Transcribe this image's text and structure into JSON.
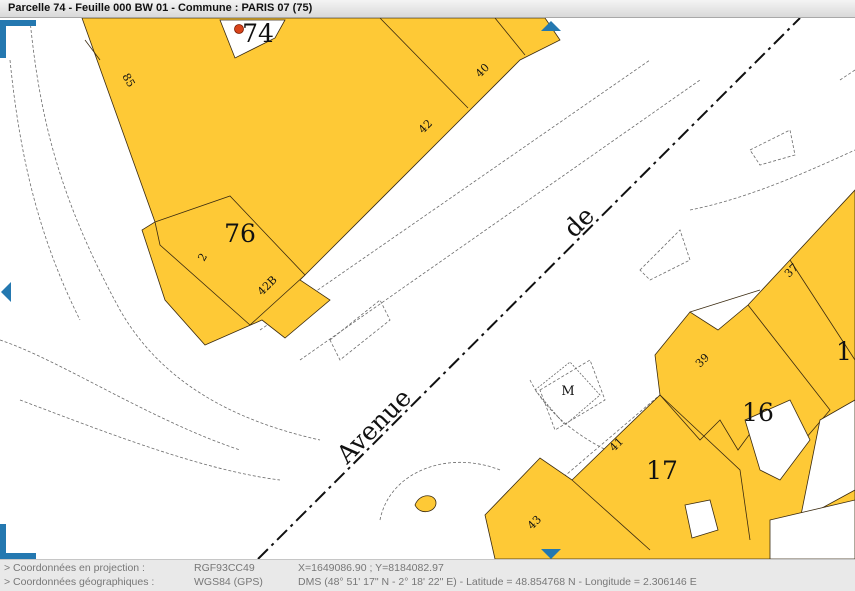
{
  "window": {
    "title": "Parcelle 74 - Feuille 000 BW 01 - Commune : PARIS 07 (75)"
  },
  "map": {
    "street_words": [
      "Avenue",
      "de"
    ],
    "metro_label": "M",
    "parcel_labels": [
      "74",
      "76",
      "16",
      "17",
      "1"
    ],
    "house_numbers": [
      "85",
      "40",
      "42",
      "2",
      "42B",
      "37",
      "39",
      "41",
      "43"
    ],
    "colors": {
      "parcel_fill": "#fec936",
      "parcel_stroke": "#3a2a10",
      "nav_arrows": "#2478b0",
      "marker": "#d8431a"
    },
    "icons": [
      "selection-marker-icon",
      "metro-icon",
      "pan-arrow-left-icon",
      "pan-arrow-up-icon",
      "pan-arrow-down-icon"
    ]
  },
  "status": {
    "projection_label": "> Coordonnées en projection :",
    "projection_system": "RGF93CC49",
    "projection_value": "X=1649086.90 ; Y=8184082.97",
    "geographic_label": "> Coordonnées géographiques :",
    "geographic_system": "WGS84 (GPS)",
    "geographic_value": "DMS (48° 51' 17\" N - 2° 18' 22\" E) - Latitude = 48.854768 N - Longitude = 2.306146 E"
  }
}
